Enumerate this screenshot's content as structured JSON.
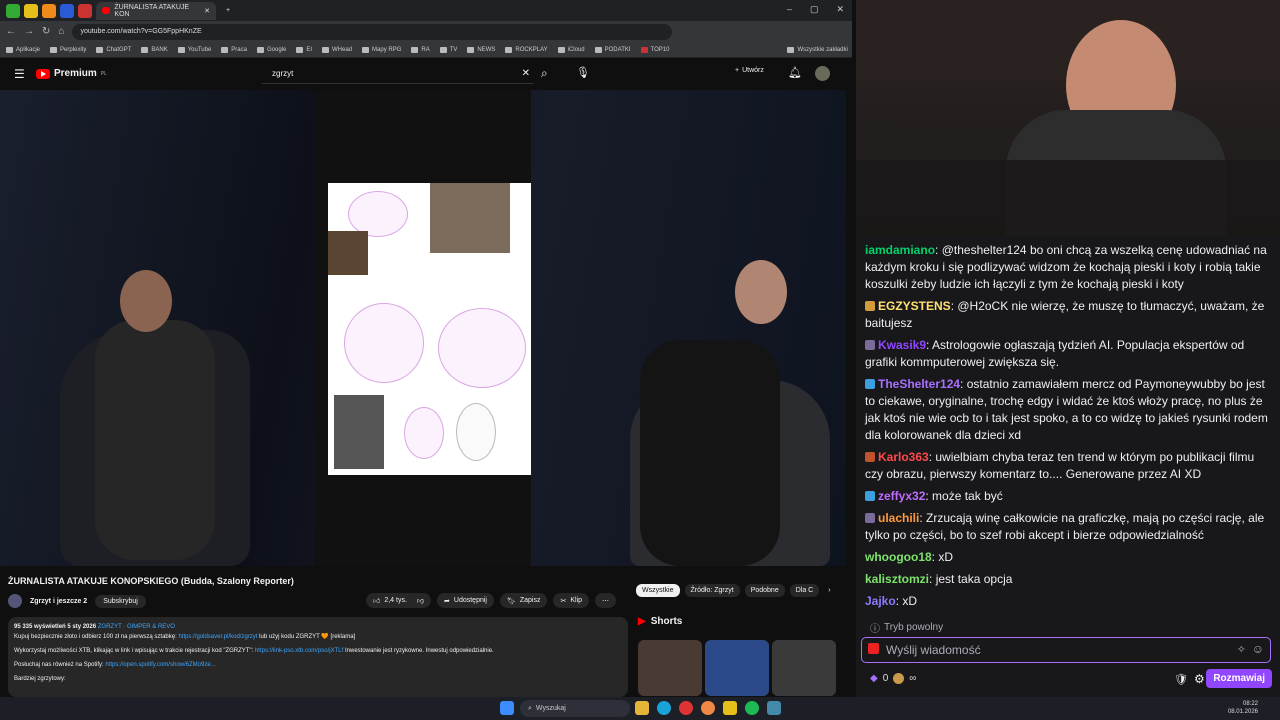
{
  "browser": {
    "active_tab": "ŻURNALISTA ATAKUJE KON",
    "url": "youtube.com/watch?v=GG5FppHKnZE",
    "bookmarks": [
      "Aplikacje",
      "Perplexity",
      "ChatGPT",
      "BANK",
      "YouTube",
      "Praca",
      "Google",
      "EI",
      "WHead",
      "Mapy RPG",
      "RA",
      "TV",
      "NEWS",
      "ROCKPLAY",
      "iCloud",
      "PODATKI",
      "TOP10"
    ],
    "all_bookmarks": "Wszystkie zakładki"
  },
  "youtube": {
    "logo": "Premium",
    "logo_sup": "PL",
    "search_value": "zgrzyt",
    "create_label": "Utwórz",
    "video_title": "ŻURNALISTA ATAKUJE KONOPSKIEGO (Budda, Szalony Reporter)",
    "channel": "Zgrzyt i jeszcze 2",
    "subscribe": "Subskrybuj",
    "likes": "2,4 tys.",
    "share": "Udostępnij",
    "save": "Zapisz",
    "clip": "Klip",
    "description": {
      "stats": "95 335 wyświetleń  5 sty 2026",
      "tags": "ZGRZYT · GIMPER & REVO",
      "line1_text": "Kupuj bezpiecznie złoto i odbierz 100 zł na pierwszą sztabkę:",
      "line1_link": "https://goldsaver.pl/kod/zgrzyt",
      "line1_tail": "lub użyj kodu ZGRZYT 🧡 [reklama]",
      "line2_text": "Wykorzystaj możliwości XTB, klikając w link i wpisując w trakcie rejestracji kod \"ZGRZYT\":",
      "line2_link": "https://link-pso.xtb.com/pso/jXTLf",
      "line2_tail": "Inwestowanie jest ryzykowne. Inwestuj odpowiedzialnie.",
      "line3_text": "Posłuchaj nas również na Spotify:",
      "line3_link": "https://open.spotify.com/show/6ZMo9ze...",
      "line4_text": "Bardziej zgrzytowy:"
    },
    "chips": [
      "Wszystkie",
      "Źródło: Zgrzyt",
      "Podobne",
      "Dla C"
    ],
    "shorts_label": "Shorts"
  },
  "chat": {
    "messages": [
      {
        "user": "iamdamiano",
        "color": "#00d26a",
        "badge": "",
        "text": "@theshelter124 bo oni chcą za wszelką cenę udowadniać na każdym kroku i się podlizywać widzom że kochają pieski i koty i robią takie koszulki żeby ludzie ich łączyli z tym że kochają pieski i koty"
      },
      {
        "user": "EGZYSTENS",
        "color": "#ffe070",
        "badge": "#d39b3a",
        "text": "@H2oCK nie wierzę, że muszę to tłumaczyć, uważam, że baitujesz"
      },
      {
        "user": "Kwasik9",
        "color": "#9146ff",
        "badge": "#7a6b9a",
        "text": "Astrologowie ogłaszają tydzień AI. Populacja ekspertów od grafiki kommputerowej zwiększa się."
      },
      {
        "user": "TheShelter124",
        "color": "#a970ff",
        "badge": "#3aa0e0",
        "text": "ostatnio zamawiałem mercz od Paymoneywubby bo jest to ciekawe, oryginalne, trochę edgy i widać że ktoś włoży pracę, no plus że jak ktoś nie wie ocb to i tak jest spoko, a to co widzę to jakieś rysunki rodem dla kolorowanek dla dzieci xd"
      },
      {
        "user": "Karlo363",
        "color": "#ff4a4a",
        "badge": "#c0532e",
        "text": "uwielbiam chyba teraz ten trend w którym po publikacji filmu czy obrazu, pierwszy komentarz to.... Generowane przez AI XD"
      },
      {
        "user": "zeffyx32",
        "color": "#bf6bff",
        "badge": "#3aa0e0",
        "text": "może tak być"
      },
      {
        "user": "ulachili",
        "color": "#ff9a3c",
        "badge": "#7a6b9a",
        "text": "Zrzucają winę całkowicie na graficzkę, mają po części rację, ale tylko po części, bo to szef robi akcept i bierze odpowiedzialność"
      },
      {
        "user": "whoogoo18",
        "color": "#7ee36b",
        "badge": "",
        "text": "xD"
      },
      {
        "user": "kalisztomzi",
        "color": "#7ee36b",
        "badge": "",
        "text": "jest taka opcja"
      },
      {
        "user": "Jajko",
        "color": "#8a7bff",
        "badge": "",
        "text": "xD"
      }
    ],
    "slow_mode": "Tryb powolny",
    "input_placeholder": "Wyślij wiadomość",
    "points": "0",
    "chat_button": "Rozmawiaj"
  },
  "taskbar": {
    "search": "Wyszukaj",
    "time": "08:22",
    "date": "08.01.2026"
  }
}
